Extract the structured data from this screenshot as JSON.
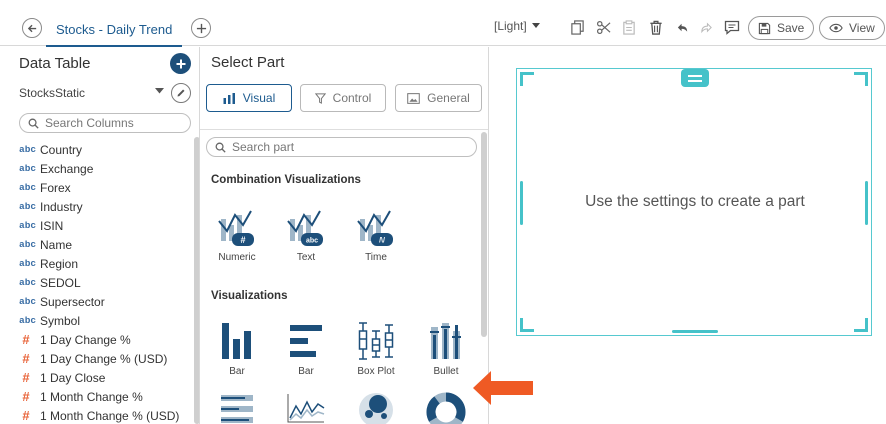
{
  "toolbar": {
    "tab_title": "Stocks - Daily Trend",
    "theme": "[Light]",
    "save_label": "Save",
    "view_label": "View"
  },
  "data_table": {
    "title": "Data Table",
    "source": "StocksStatic",
    "search_placeholder": "Search Columns",
    "columns": [
      {
        "type": "abc",
        "name": "Country"
      },
      {
        "type": "abc",
        "name": "Exchange"
      },
      {
        "type": "abc",
        "name": "Forex"
      },
      {
        "type": "abc",
        "name": "Industry"
      },
      {
        "type": "abc",
        "name": "ISIN"
      },
      {
        "type": "abc",
        "name": "Name"
      },
      {
        "type": "abc",
        "name": "Region"
      },
      {
        "type": "abc",
        "name": "SEDOL"
      },
      {
        "type": "abc",
        "name": "Supersector"
      },
      {
        "type": "abc",
        "name": "Symbol"
      },
      {
        "type": "#",
        "name": "1 Day Change %"
      },
      {
        "type": "#",
        "name": "1 Day Change % (USD)"
      },
      {
        "type": "#",
        "name": "1 Day Close"
      },
      {
        "type": "#",
        "name": "1 Month Change %"
      },
      {
        "type": "#",
        "name": "1 Month Change % (USD)"
      }
    ]
  },
  "select_part": {
    "title": "Select Part",
    "tabs": [
      {
        "label": "Visual",
        "active": true
      },
      {
        "label": "Control",
        "active": false
      },
      {
        "label": "General",
        "active": false
      }
    ],
    "search_placeholder": "Search part",
    "combination_heading": "Combination Visualizations",
    "combination_items": [
      {
        "label": "Numeric",
        "badge": "#"
      },
      {
        "label": "Text",
        "badge": "abc"
      },
      {
        "label": "Time",
        "badge": "/\\/"
      }
    ],
    "visualizations_heading": "Visualizations",
    "visualization_items": [
      {
        "label": "Bar",
        "icon": "bar-vertical-icon"
      },
      {
        "label": "Bar",
        "icon": "bar-horizontal-icon"
      },
      {
        "label": "Box Plot",
        "icon": "box-plot-icon"
      },
      {
        "label": "Bullet",
        "icon": "bullet-icon"
      }
    ]
  },
  "canvas": {
    "placeholder": "Use the settings to create a part"
  },
  "colors": {
    "accent": "#1d5b8f",
    "teal": "#45c2c9",
    "number_type": "#e8643a",
    "arrow": "#ef5a24"
  }
}
